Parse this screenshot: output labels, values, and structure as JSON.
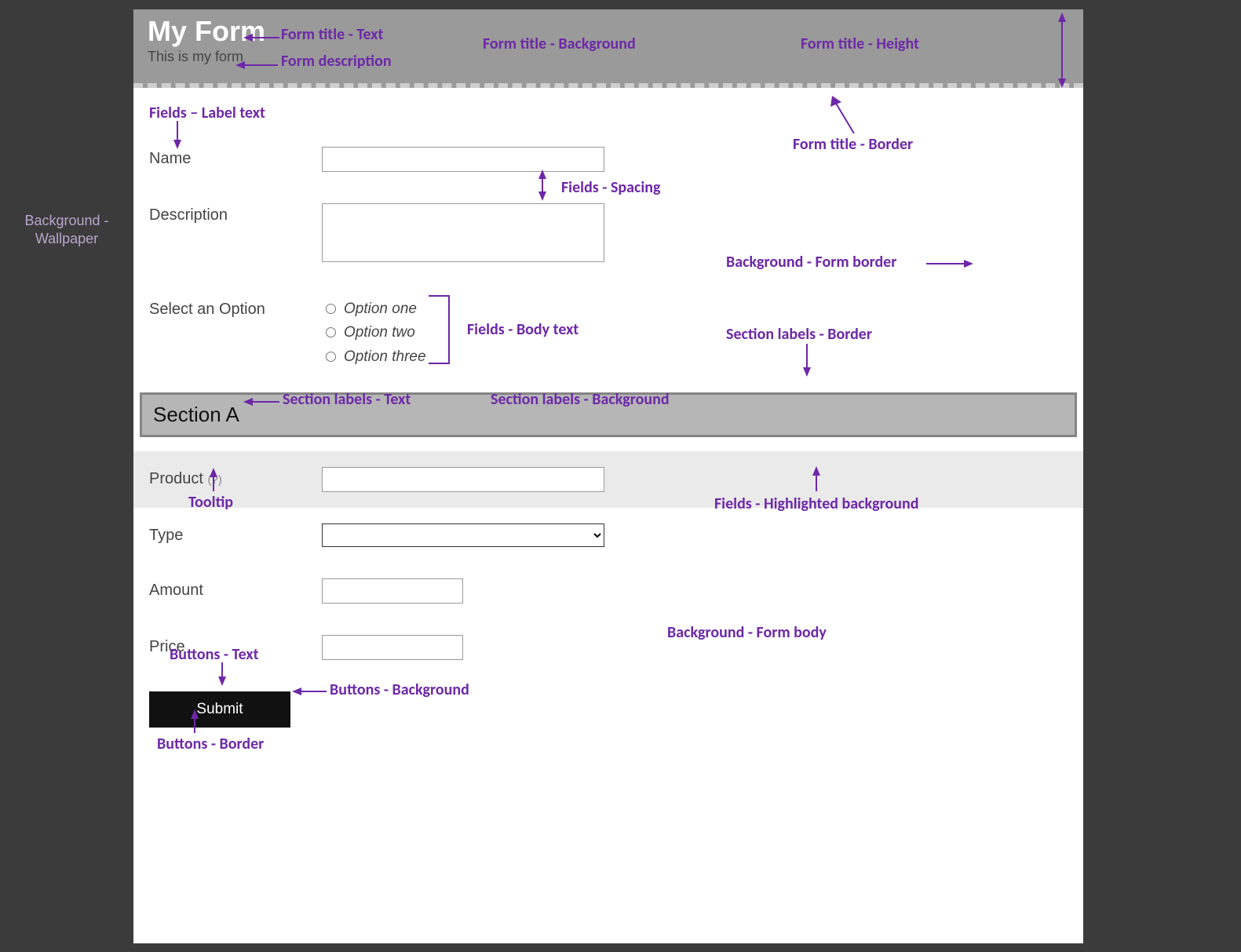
{
  "wallpaper_label_l1": "Background -",
  "wallpaper_label_l2": "Wallpaper",
  "form": {
    "title": "My Form",
    "description": "This is my form",
    "fields": {
      "name_label": "Name",
      "description_label": "Description",
      "select_label": "Select an Option",
      "options": [
        "Option one",
        "Option two",
        "Option three"
      ],
      "section_a": "Section A",
      "product_label": "Product",
      "product_tooltip": "(?)",
      "type_label": "Type",
      "amount_label": "Amount",
      "price_label": "Price"
    },
    "button_submit": "Submit"
  },
  "annotations": {
    "form_title_text": "Form title - Text",
    "form_description": "Form description",
    "form_title_background": "Form title - Background",
    "form_title_height": "Form title - Height",
    "form_title_border": "Form title - Border",
    "fields_label_text": "Fields – Label text",
    "fields_spacing": "Fields - Spacing",
    "fields_body_text": "Fields - Body text",
    "background_form_border": "Background - Form border",
    "section_labels_border": "Section labels - Border",
    "section_labels_text": "Section labels - Text",
    "section_labels_background": "Section labels - Background",
    "tooltip": "Tooltip",
    "fields_highlighted_background": "Fields - Highlighted background",
    "buttons_text": "Buttons - Text",
    "buttons_background": "Buttons - Background",
    "buttons_border": "Buttons - Border",
    "background_form_body": "Background -  Form body"
  }
}
